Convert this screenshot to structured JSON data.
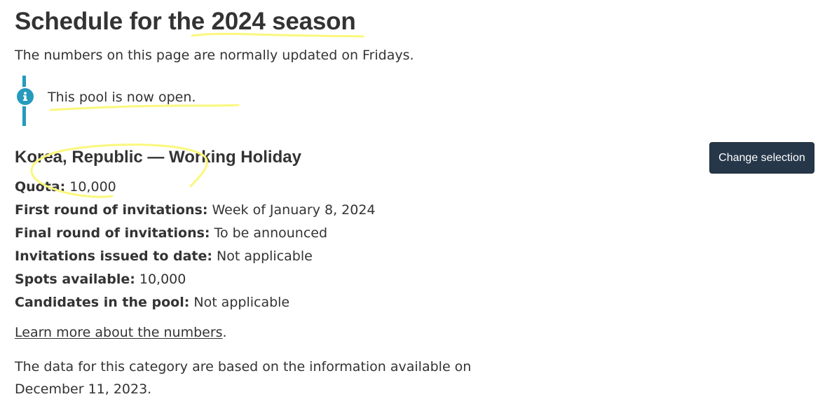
{
  "header": {
    "title": "Schedule for the 2024 season",
    "subtitle": "The numbers on this page are normally updated on Fridays."
  },
  "notice": {
    "icon": "info-icon",
    "text": "This pool is now open.",
    "color": "#269abc"
  },
  "category": {
    "title": "Korea, Republic — Working Holiday",
    "change_button": "Change selection",
    "button_color": "#26374a"
  },
  "stats": [
    {
      "label": "Quota:",
      "value": "10,000"
    },
    {
      "label": "First round of invitations:",
      "value": "Week of January 8, 2024"
    },
    {
      "label": "Final round of invitations:",
      "value": "To be announced"
    },
    {
      "label": "Invitations issued to date:",
      "value": "Not applicable"
    },
    {
      "label": "Spots available:",
      "value": "10,000"
    },
    {
      "label": "Candidates in the pool:",
      "value": "Not applicable"
    }
  ],
  "learn_more": {
    "link": "Learn more about the numbers",
    "suffix": "."
  },
  "data_note": "The data for this category are based on the information available on December 11, 2023.",
  "annotation_color": "#fbf77c"
}
